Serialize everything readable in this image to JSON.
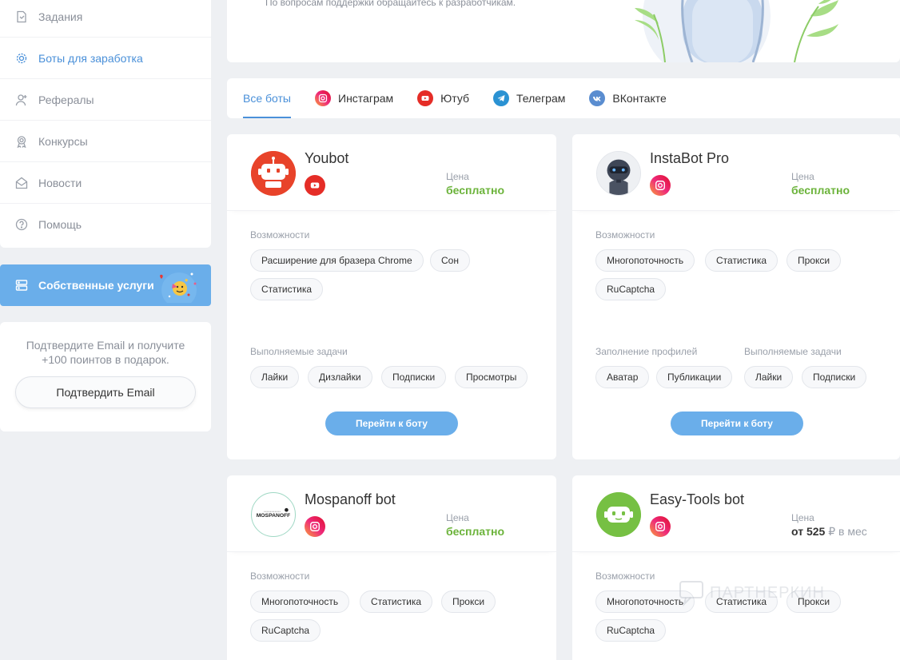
{
  "sidebar": {
    "items": [
      {
        "label": "Задания",
        "icon": "task-icon"
      },
      {
        "label": "Боты для заработка",
        "icon": "gear-icon"
      },
      {
        "label": "Рефералы",
        "icon": "user-plus-icon"
      },
      {
        "label": "Конкурсы",
        "icon": "medal-icon"
      },
      {
        "label": "Новости",
        "icon": "mail-icon"
      },
      {
        "label": "Помощь",
        "icon": "help-icon"
      }
    ],
    "own_services": "Собственные услуги",
    "email_prompt": "Подтвердите Email и получите +100 поинтов в подарок.",
    "email_button": "Подтвердить Email"
  },
  "banner": {
    "text": "По вопросам поддержки обращайтесь к разработчикам."
  },
  "tabs": [
    {
      "label": "Все боты",
      "icon": ""
    },
    {
      "label": "Инстаграм",
      "icon": "instagram-icon"
    },
    {
      "label": "Ютуб",
      "icon": "youtube-icon"
    },
    {
      "label": "Телеграм",
      "icon": "telegram-icon"
    },
    {
      "label": "ВКонтакте",
      "icon": "vk-icon"
    }
  ],
  "common": {
    "price_label": "Цена",
    "features_label": "Возможности",
    "tasks_label": "Выполняемые задачи",
    "profile_label": "Заполнение профилей",
    "go_button": "Перейти к боту"
  },
  "bots": [
    {
      "name": "Youbot",
      "platform": "youtube-icon",
      "price": "бесплатно",
      "features": [
        "Расширение для бразера Chrome",
        "Сон",
        "Статистика"
      ],
      "tasks": [
        "Лайки",
        "Дизлайки",
        "Подписки",
        "Просмотры"
      ]
    },
    {
      "name": "InstaBot Pro",
      "platform": "instagram-icon",
      "price": "бесплатно",
      "features": [
        "Многопоточность",
        "Статистика",
        "Прокси",
        "RuCaptcha"
      ],
      "profile": [
        "Аватар",
        "Публикации"
      ],
      "tasks": [
        "Лайки",
        "Подписки"
      ]
    },
    {
      "name": "Mospanoff bot",
      "platform": "instagram-icon",
      "price": "бесплатно",
      "logo_text": "MOSPANOFF",
      "features": [
        "Многопоточность",
        "Статистика",
        "Прокси",
        "RuCaptcha"
      ]
    },
    {
      "name": "Easy-Tools bot",
      "platform": "instagram-icon",
      "price_prefix": "от 525",
      "price_unit": "₽ в мес",
      "features": [
        "Многопоточность",
        "Статистика",
        "Прокси",
        "RuCaptcha"
      ]
    }
  ],
  "watermark": "ПАРТНЕРКИН",
  "colors": {
    "accent": "#4a90d9",
    "button": "#6aaeea",
    "free": "#6bb33a",
    "background": "#eef0f3"
  }
}
